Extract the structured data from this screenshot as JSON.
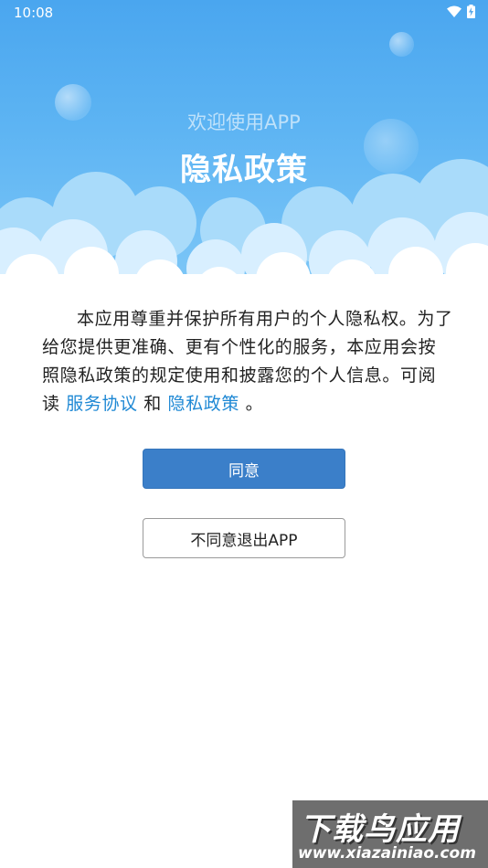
{
  "status_bar": {
    "time": "10:08",
    "wifi_icon": "wifi-icon",
    "battery_icon": "battery-charging-icon"
  },
  "header": {
    "welcome": "欢迎使用APP",
    "title": "隐私政策"
  },
  "content": {
    "text_before": "本应用尊重并保护所有用户的个人隐私权。为了给您提供更准确、更有个性化的服务，本应用会按照隐私政策的规定使用和披露您的个人信息。可阅读 ",
    "link_service": "服务协议",
    "text_and": " 和 ",
    "link_privacy": "隐私政策",
    "text_end": " 。"
  },
  "buttons": {
    "agree": "同意",
    "disagree": "不同意退出APP"
  },
  "watermark": {
    "main": "下载鸟应用",
    "sub": "www.xiazainiao.com"
  },
  "colors": {
    "sky_top": "#4aa6ef",
    "sky_bottom": "#7cc6f7",
    "link": "#1e88d4",
    "primary_button": "#3b7fc9"
  }
}
